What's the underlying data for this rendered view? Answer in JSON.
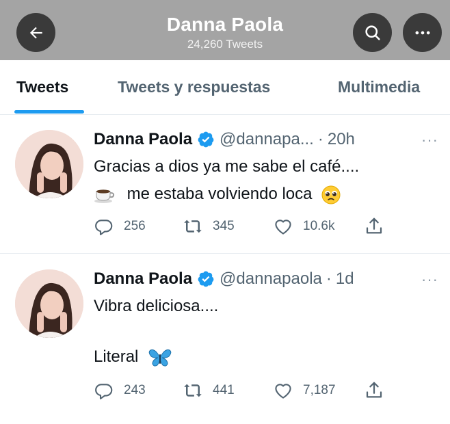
{
  "header": {
    "title": "Danna Paola",
    "subtitle": "24,260 Tweets",
    "icons": {
      "back": "arrow-left-icon",
      "search": "search-icon",
      "more": "more-horizontal-icon"
    }
  },
  "tabs": [
    {
      "label": "Tweets",
      "active": true
    },
    {
      "label": "Tweets y respuestas",
      "active": false
    },
    {
      "label": "Multimedia",
      "active": false
    }
  ],
  "tweets": [
    {
      "name": "Danna Paola",
      "handle": "@dannapa...",
      "separator": "·",
      "time": "20h",
      "more": "···",
      "lines": [
        "Gracias a dios ya me sabe el café....",
        "me estaba volviendo loca"
      ],
      "emojis": [
        "coffee-cup-icon",
        "pleading-face-icon"
      ],
      "replies": "256",
      "retweets": "345",
      "likes": "10.6k"
    },
    {
      "name": "Danna Paola",
      "handle": "@dannapaola",
      "separator": "·",
      "time": "1d",
      "more": "···",
      "lines": [
        "Vibra deliciosa....",
        "",
        "Literal"
      ],
      "emojis": [
        "butterfly-icon"
      ],
      "replies": "243",
      "retweets": "441",
      "likes": "7,187"
    }
  ],
  "colors": {
    "accent": "#1d9bf0",
    "header_bg": "#a4a4a4",
    "header_button_bg": "#3a3a3a",
    "muted_text": "#536471",
    "verified": "#1d9bf0"
  }
}
